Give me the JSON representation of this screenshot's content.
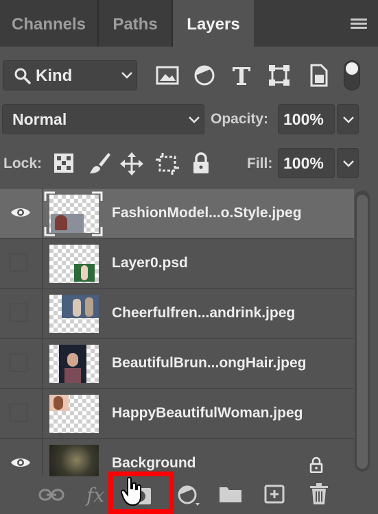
{
  "tabs": [
    {
      "label": "Channels",
      "active": false
    },
    {
      "label": "Paths",
      "active": false
    },
    {
      "label": "Layers",
      "active": true
    }
  ],
  "filter": {
    "kind_label": "Kind",
    "icons": [
      "image-filter-icon",
      "adjustment-filter-icon",
      "type-filter-icon",
      "shape-filter-icon",
      "smart-object-filter-icon",
      "filter-toggle-icon"
    ]
  },
  "blend": {
    "mode": "Normal",
    "opacity_label": "Opacity:",
    "opacity_value": "100%",
    "lock_label": "Lock:",
    "fill_label": "Fill:",
    "fill_value": "100%"
  },
  "layers": [
    {
      "name": "FashionModel...o.Style.jpeg",
      "visible": true,
      "selected": true
    },
    {
      "name": "Layer0.psd",
      "visible": false,
      "selected": false
    },
    {
      "name": "Cheerfulfren...andrink.jpeg",
      "visible": false,
      "selected": false
    },
    {
      "name": "BeautifulBrun...ongHair.jpeg",
      "visible": false,
      "selected": false
    },
    {
      "name": "HappyBeautifulWoman.jpeg",
      "visible": false,
      "selected": false
    },
    {
      "name": "Background",
      "visible": true,
      "selected": false,
      "locked": true
    }
  ],
  "bottom_icons": [
    "link-icon",
    "fx-icon",
    "add-mask-icon",
    "adjustment-layer-icon",
    "new-group-icon",
    "new-layer-icon",
    "delete-icon"
  ],
  "colors": {
    "panel": "#535353",
    "tabbar": "#3c3c3c",
    "selected_row": "#6a6a6a",
    "highlight": "#ff0000"
  }
}
